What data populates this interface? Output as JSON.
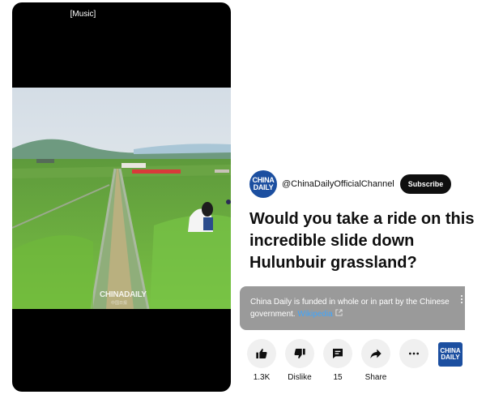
{
  "player": {
    "caption": "[Music]",
    "watermark": "CHINADAILY",
    "watermark_sub": "中国日报"
  },
  "channel": {
    "avatar_line1": "CHINA",
    "avatar_line2": "DAILY",
    "handle": "@ChinaDailyOfficialChannel",
    "subscribe_label": "Subscribe"
  },
  "video": {
    "title": "Would you take a ride on this incredible slide down Hulunbuir grassland?"
  },
  "info_panel": {
    "text": "China Daily is funded in whole or in part by the Chinese government.",
    "link_text": "Wikipedia"
  },
  "actions": {
    "like_count": "1.3K",
    "dislike_label": "Dislike",
    "comment_count": "15",
    "share_label": "Share"
  },
  "brand_badge": {
    "line1": "CHINA",
    "line2": "DAILY"
  },
  "colors": {
    "brand": "#1c4fa0",
    "subscribe_bg": "#0f0f0f",
    "link": "#3ea6ff",
    "info_bg": "#9a9a9a"
  }
}
